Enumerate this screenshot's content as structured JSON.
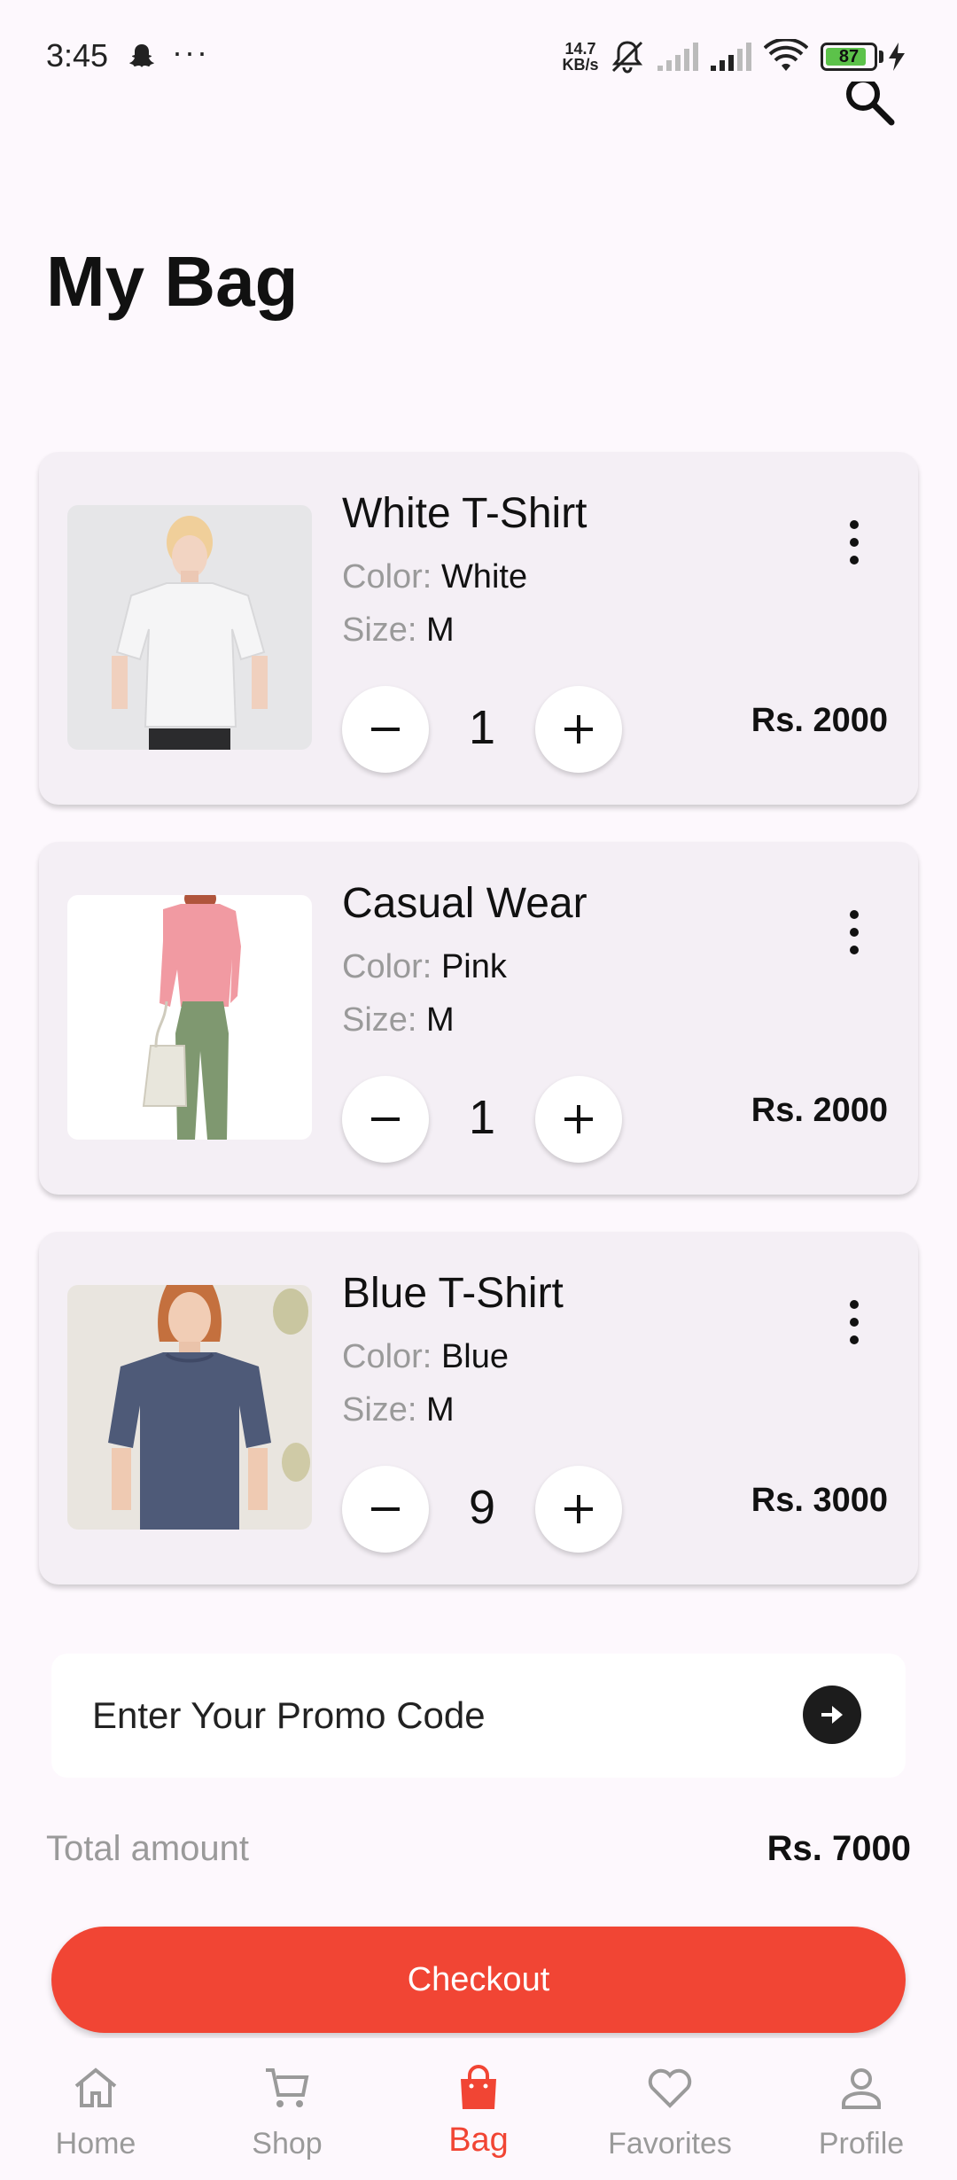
{
  "status_bar": {
    "time": "3:45",
    "net_speed_value": "14.7",
    "net_speed_unit": "KB/s",
    "battery_level": "87",
    "battery_fraction": 0.87,
    "icons": [
      "snapchat-icon",
      "more-dots-icon",
      "mute-icon",
      "signal-icon",
      "signal-icon",
      "wifi-icon",
      "battery-icon",
      "charging-icon"
    ]
  },
  "header": {
    "title": "My Bag",
    "search_icon": "search-icon"
  },
  "cart": {
    "color_label": "Color:",
    "size_label": "Size:",
    "items": [
      {
        "name": "White T-Shirt",
        "color": "White",
        "size": "M",
        "quantity": "1",
        "price": "Rs. 2000"
      },
      {
        "name": "Casual Wear",
        "color": "Pink",
        "size": "M",
        "quantity": "1",
        "price": "Rs. 2000"
      },
      {
        "name": "Blue T-Shirt",
        "color": "Blue",
        "size": "M",
        "quantity": "9",
        "price": "Rs. 3000"
      }
    ]
  },
  "promo": {
    "placeholder": "Enter Your Promo Code"
  },
  "summary": {
    "total_label": "Total amount",
    "total_value": "Rs. 7000"
  },
  "checkout": {
    "label": "Checkout",
    "color": "#f14534"
  },
  "bottom_nav": {
    "active": "Bag",
    "active_color": "#f14534",
    "items": [
      {
        "label": "Home",
        "icon": "home-icon"
      },
      {
        "label": "Shop",
        "icon": "cart-icon"
      },
      {
        "label": "Bag",
        "icon": "bag-icon"
      },
      {
        "label": "Favorites",
        "icon": "heart-icon"
      },
      {
        "label": "Profile",
        "icon": "profile-icon"
      }
    ]
  }
}
